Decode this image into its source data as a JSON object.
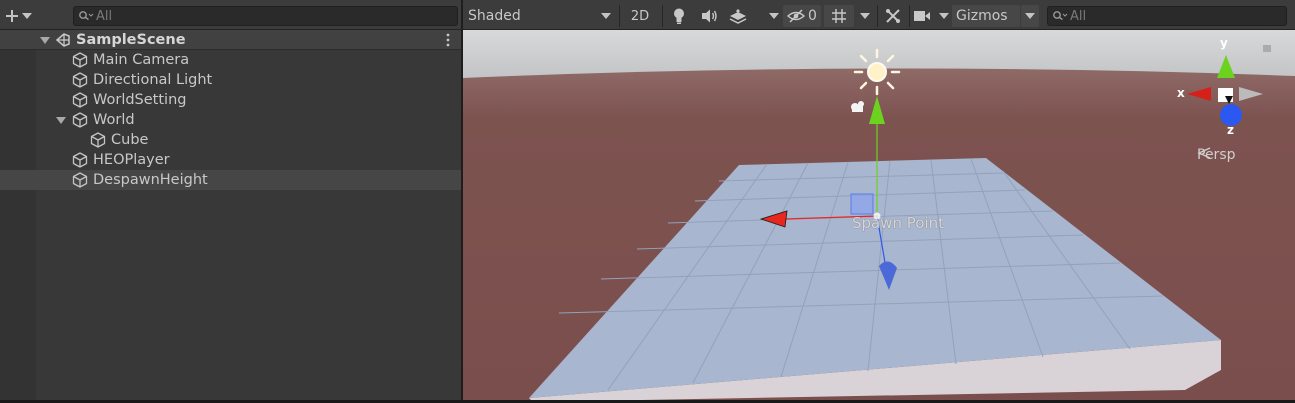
{
  "hierarchy": {
    "add_icon": "plus-icon",
    "search": {
      "placeholder": "All"
    },
    "scene": {
      "name": "SampleScene",
      "icon": "unity-scene-icon"
    },
    "items": [
      {
        "name": "Main Camera",
        "icon": "gameobject-cube-icon"
      },
      {
        "name": "Directional Light",
        "icon": "gameobject-cube-icon"
      },
      {
        "name": "WorldSetting",
        "icon": "gameobject-cube-icon"
      },
      {
        "name": "World",
        "icon": "gameobject-cube-icon",
        "expanded": true
      },
      {
        "name": "Cube",
        "icon": "gameobject-cube-icon",
        "parent": "World"
      },
      {
        "name": "HEOPlayer",
        "icon": "gameobject-cube-icon"
      },
      {
        "name": "DespawnHeight",
        "icon": "gameobject-cube-icon",
        "selected": true
      }
    ]
  },
  "scene_view": {
    "toolbar": {
      "shading_mode": "Shaded",
      "mode_2d": "2D",
      "hidden_count": "0",
      "gizmos": "Gizmos",
      "search_placeholder": "All"
    },
    "viewport": {
      "spawn_point_label": "Spawn Point",
      "projection": "Persp",
      "axis_x": "x",
      "axis_y": "y",
      "axis_z": "z"
    },
    "colors": {
      "sky": "#cfd0d1",
      "ground": "#7e5452",
      "plane_top": "#a9b6cf",
      "plane_side": "#d9d2d6",
      "x_axis": "#e8281f",
      "y_axis": "#6bd320",
      "z_axis": "#2b58f0"
    }
  }
}
